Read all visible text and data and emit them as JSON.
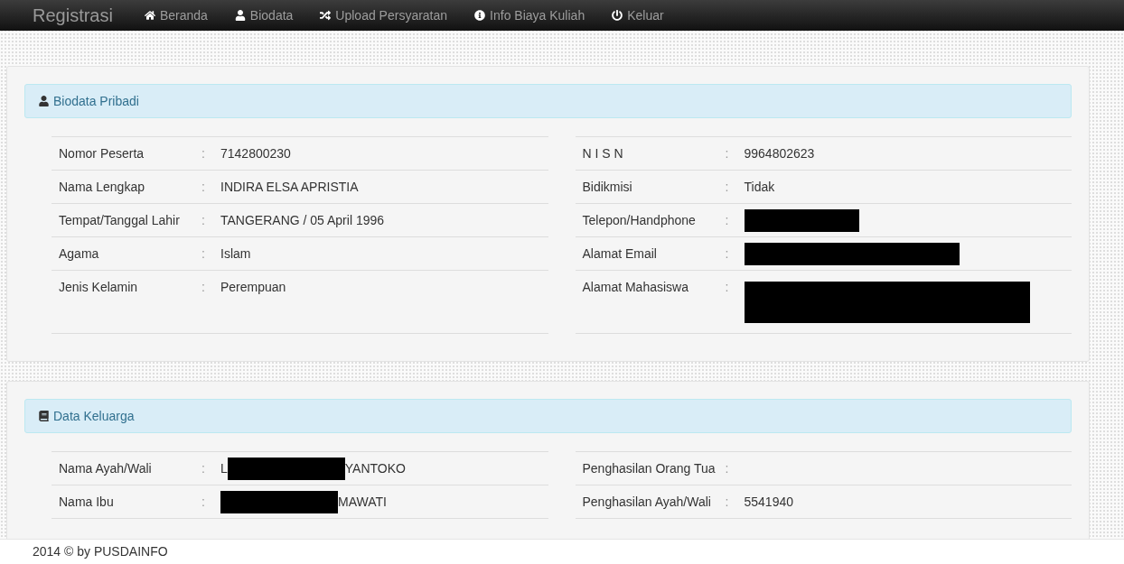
{
  "navbar": {
    "brand": "Registrasi",
    "items": [
      {
        "kind": "home",
        "label": "Beranda"
      },
      {
        "kind": "user",
        "label": "Biodata"
      },
      {
        "kind": "shuffle",
        "label": "Upload Persyaratan"
      },
      {
        "kind": "info",
        "label": "Info Biaya Kuliah"
      },
      {
        "kind": "power",
        "label": "Keluar"
      }
    ]
  },
  "panels": [
    {
      "kind": "user",
      "title": "Biodata Pribadi",
      "columns": [
        [
          {
            "kind": "plain",
            "label": "Nomor Peserta",
            "separator": ":",
            "value": "7142800230"
          },
          {
            "kind": "plain",
            "label": "Nama Lengkap",
            "separator": ":",
            "value": "INDIRA ELSA APRISTIA"
          },
          {
            "kind": "plain",
            "label": "Tempat/Tanggal Lahir",
            "separator": ":",
            "value": "TANGERANG / 05 April 1996"
          },
          {
            "kind": "plain",
            "label": "Agama",
            "separator": ":",
            "value": "Islam"
          },
          {
            "kind": "plain",
            "label": "Jenis Kelamin",
            "separator": ":",
            "value": "Perempuan"
          }
        ],
        [
          {
            "kind": "plain",
            "label": "N I S N",
            "separator": ":",
            "value": "9964802623"
          },
          {
            "kind": "plain",
            "label": "Bidikmisi",
            "separator": ":",
            "value": "Tidak"
          },
          {
            "kind": "redacted_short",
            "label": "Telepon/Handphone",
            "separator": ":"
          },
          {
            "kind": "redacted_long",
            "label": "Alamat Email",
            "separator": ":"
          },
          {
            "kind": "redacted_block",
            "label": "Alamat Mahasiswa",
            "separator": ":"
          }
        ]
      ]
    },
    {
      "kind": "book",
      "title": "Data Keluarga",
      "columns": [
        [
          {
            "kind": "redacted_middle",
            "label": "Nama Ayah/Wali",
            "separator": ":",
            "value": "L",
            "value_after": "YANTOKO"
          },
          {
            "kind": "redacted_middle",
            "label": "Nama Ibu",
            "separator": ":",
            "value_after": "MAWATI"
          }
        ],
        [
          {
            "kind": "plain",
            "label": "Penghasilan Orang Tua",
            "separator": ":"
          },
          {
            "kind": "plain",
            "label": "Penghasilan Ayah/Wali",
            "separator": ":",
            "value": "5541940"
          }
        ]
      ]
    }
  ],
  "footer": "2014 © by PUSDAINFO"
}
